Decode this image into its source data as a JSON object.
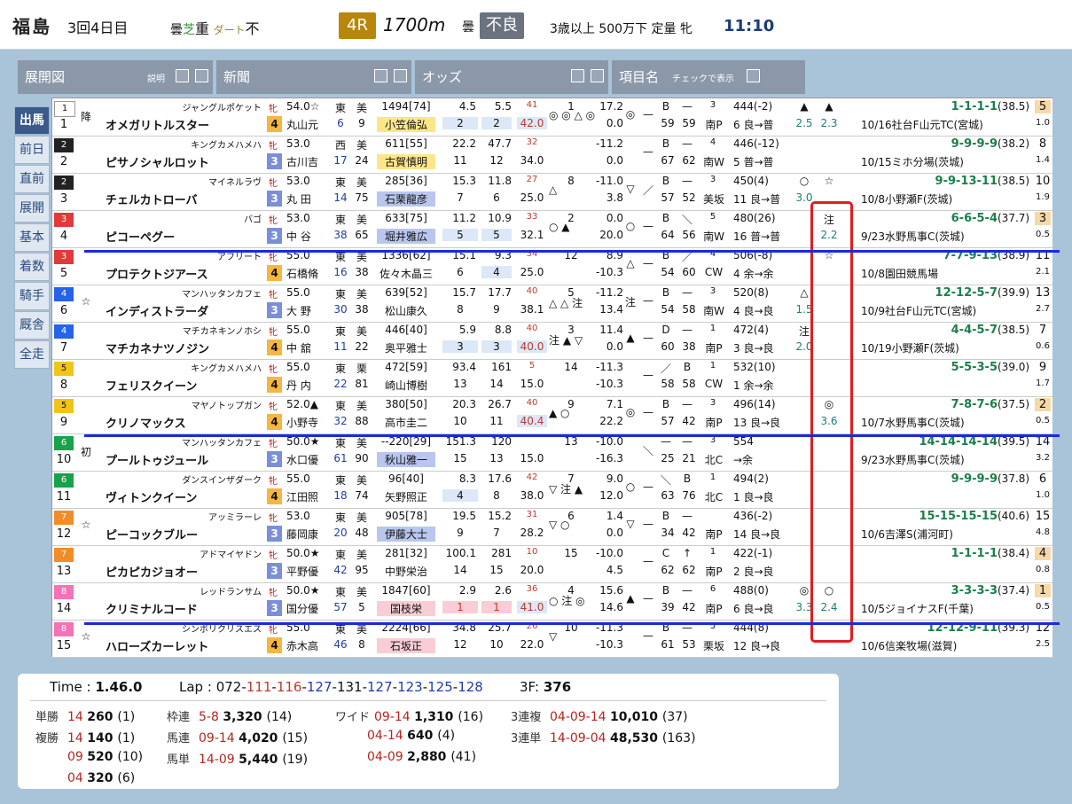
{
  "header": {
    "place": "福島",
    "kai": "3回4日目",
    "turf_label": "曇",
    "turf_kind": "芝",
    "turf_state": "重",
    "dirt_label": "ダート",
    "dirt_state": "不",
    "race_no": "4R",
    "distance": "1700m",
    "weather": "曇",
    "condition": "不良",
    "race_class": "3歳以上 500万下 定量 牝",
    "post_time": "11:10"
  },
  "panels": [
    {
      "title": "展開図",
      "sub": "説明"
    },
    {
      "title": "新聞",
      "sub": ""
    },
    {
      "title": "オッズ",
      "sub": ""
    },
    {
      "title": "項目名",
      "sub": "チェックで表示"
    }
  ],
  "menu": [
    "出馬",
    "前日",
    "直前",
    "展開",
    "基本",
    "着数",
    "騎手",
    "厩舎",
    "全走"
  ],
  "horses": [
    {
      "frame": "1",
      "frame_color": "#ffffff",
      "no": "1",
      "mark": "降",
      "sire": "ジャングルポケット",
      "name": "オメガリトルスター",
      "sex": "牝",
      "age": "4",
      "weight": "54.0☆",
      "jockey": "丸山元",
      "e": "東",
      "m": "美",
      "r1": "6",
      "r2": "9",
      "stat": "1494[74]",
      "trainer": "小笠倫弘",
      "tclass": "jk",
      "o1": "4.5",
      "o2": "5.5",
      "o3": "2",
      "o4": "2",
      "pop": "41",
      "odds": "42.0",
      "marks": "◎ ◎ △ ◎",
      "pos": "1",
      "v1": "17.2",
      "v2": "0.0",
      "c1": "◎",
      "c2": "—",
      "c3": "B",
      "c4": "—",
      "c5": "59",
      "c6": "59",
      "cn": "3",
      "course": "南P",
      "wt": "444(-2)",
      "wt2": "6 良→普",
      "x1": "▲",
      "x2": "▲",
      "x3": "2.5",
      "x4": "2.3",
      "pass": "1-1-1-1",
      "last": "(38.5)",
      "prev": "10/16社台F山元TC(宮城)",
      "rank": "5",
      "rank2": "1.0"
    },
    {
      "frame": "2",
      "frame_color": "#222222",
      "no": "2",
      "mark": "",
      "sire": "キングカメハメハ",
      "name": "ピサノシャルロット",
      "sex": "牝",
      "age": "3",
      "weight": "53.0",
      "jockey": "古川吉",
      "e": "西",
      "m": "美",
      "r1": "17",
      "r2": "24",
      "stat": "611[55]",
      "trainer": "古賀慎明",
      "tclass": "jk",
      "o1": "22.2",
      "o2": "47.7",
      "o3": "11",
      "o4": "12",
      "pop": "32",
      "odds": "34.0",
      "marks": "",
      "pos": "",
      "v1": "-11.2",
      "v2": "0.0",
      "c1": "",
      "c2": "—",
      "c3": "B",
      "c4": "—",
      "c5": "67",
      "c6": "62",
      "cn": "4",
      "course": "南W",
      "wt": "446(-12)",
      "wt2": "5 普→普",
      "x1": "",
      "x2": "",
      "x3": "",
      "x4": "",
      "pass": "9-9-9-9",
      "last": "(38.2)",
      "prev": "10/15ミホ分場(茨城)",
      "rank": "8",
      "rank2": "1.4"
    },
    {
      "frame": "2",
      "frame_color": "#222222",
      "no": "3",
      "mark": "",
      "sire": "マイネルラヴ",
      "name": "チェルカトローバ",
      "sex": "牝",
      "age": "3",
      "weight": "53.0",
      "jockey": "丸 田",
      "e": "東",
      "m": "美",
      "r1": "14",
      "r2": "75",
      "stat": "285[36]",
      "trainer": "石栗龍彦",
      "tclass": "pos3bg",
      "o1": "15.3",
      "o2": "11.8",
      "o3": "7",
      "o4": "6",
      "pop": "27",
      "odds": "25.0",
      "marks": "△",
      "pos": "8",
      "v1": "-11.0",
      "v2": "3.8",
      "c1": "▽",
      "c2": "／",
      "c3": "B",
      "c4": "—",
      "c5": "57",
      "c6": "52",
      "cn": "3",
      "course": "美坂",
      "wt": "450(4)",
      "wt2": "11 良→普",
      "x1": "○",
      "x2": "☆",
      "x3": "3.0",
      "x4": "",
      "pass": "9-9-13-11",
      "last": "(38.5)",
      "prev": "10/8小野瀬F(茨城)",
      "rank": "10",
      "rank2": "1.9"
    },
    {
      "frame": "3",
      "frame_color": "#e03a3a",
      "no": "4",
      "mark": "",
      "sire": "バゴ",
      "name": "ピコーペグー",
      "sex": "牝",
      "age": "3",
      "weight": "53.0",
      "jockey": "中 谷",
      "e": "東",
      "m": "美",
      "r1": "38",
      "r2": "65",
      "stat": "633[75]",
      "trainer": "堀井雅広",
      "tclass": "pos3bg",
      "o1": "11.2",
      "o2": "10.9",
      "o3": "5",
      "o4": "5",
      "pop": "33",
      "odds": "32.1",
      "marks": "○ ▲",
      "pos": "2",
      "v1": "0.0",
      "v2": "20.0",
      "c1": "○",
      "c2": "—",
      "c3": "B",
      "c4": "＼",
      "c5": "64",
      "c6": "56",
      "cn": "5",
      "course": "南W",
      "wt": "480(26)",
      "wt2": "16 普→普",
      "x1": "",
      "x2": "注",
      "x3": "",
      "x4": "2.2",
      "pass": "6-6-5-4",
      "last": "(37.7)",
      "prev": "9/23水野馬事C(茨城)",
      "rank": "3",
      "rank2": "0.5"
    },
    {
      "frame": "3",
      "frame_color": "#e03a3a",
      "no": "5",
      "mark": "",
      "sire": "アフリート",
      "name": "プロテクトジアース",
      "sex": "牝",
      "age": "4",
      "weight": "55.0",
      "jockey": "石橋脩",
      "e": "東",
      "m": "美",
      "r1": "16",
      "r2": "38",
      "stat": "1336[62]",
      "trainer": "佐々木晶三",
      "tclass": "",
      "o1": "15.1",
      "o2": "9.3",
      "o3": "6",
      "o4": "4",
      "pop": "34",
      "odds": "25.0",
      "marks": "",
      "pos": "12",
      "v1": "8.9",
      "v2": "-10.3",
      "c1": "△",
      "c2": "—",
      "c3": "B",
      "c4": "／",
      "c5": "54",
      "c6": "60",
      "cn": "4",
      "course": "CW",
      "wt": "506(-8)",
      "wt2": "4 余→余",
      "x1": "",
      "x2": "☆",
      "x3": "",
      "x4": "",
      "pass": "7-7-9-13",
      "last": "(38.9)",
      "prev": "10/8園田競馬場",
      "rank": "11",
      "rank2": "2.1"
    },
    {
      "frame": "4",
      "frame_color": "#2563eb",
      "no": "6",
      "mark": "☆",
      "sire": "マンハッタンカフェ",
      "name": "インディストラーダ",
      "sex": "牝",
      "age": "3",
      "weight": "55.0",
      "jockey": "大 野",
      "e": "東",
      "m": "美",
      "r1": "30",
      "r2": "38",
      "stat": "639[52]",
      "trainer": "松山康久",
      "tclass": "",
      "o1": "15.7",
      "o2": "17.7",
      "o3": "8",
      "o4": "9",
      "pop": "40",
      "odds": "38.1",
      "marks": "△ △ 注",
      "pos": "5",
      "v1": "-11.2",
      "v2": "13.4",
      "c1": "注",
      "c2": "—",
      "c3": "B",
      "c4": "—",
      "c5": "54",
      "c6": "58",
      "cn": "3",
      "course": "南W",
      "wt": "520(8)",
      "wt2": "4 良→良",
      "x1": "△",
      "x2": "",
      "x3": "1.5",
      "x4": "",
      "pass": "12-12-5-7",
      "last": "(39.9)",
      "prev": "10/9社台F山元TC(宮城)",
      "rank": "13",
      "rank2": "2.7"
    },
    {
      "frame": "4",
      "frame_color": "#2563eb",
      "no": "7",
      "mark": "",
      "sire": "マチカネキンノホシ",
      "name": "マチカネナツノジン",
      "sex": "牝",
      "age": "4",
      "weight": "55.0",
      "jockey": "中 舘",
      "e": "東",
      "m": "美",
      "r1": "11",
      "r2": "22",
      "stat": "446[40]",
      "trainer": "奥平雅士",
      "tclass": "",
      "o1": "5.9",
      "o2": "8.8",
      "o3": "3",
      "o4": "3",
      "pop": "40",
      "odds": "40.0",
      "marks": "注 ▲ ▽",
      "pos": "3",
      "v1": "11.4",
      "v2": "0.0",
      "c1": "▲",
      "c2": "—",
      "c3": "D",
      "c4": "—",
      "c5": "60",
      "c6": "38",
      "cn": "1",
      "course": "南P",
      "wt": "472(4)",
      "wt2": "3 良→良",
      "x1": "注",
      "x2": "",
      "x3": "2.0",
      "x4": "",
      "pass": "4-4-5-7",
      "last": "(38.5)",
      "prev": "10/19小野瀬F(茨城)",
      "rank": "7",
      "rank2": "0.6"
    },
    {
      "frame": "5",
      "frame_color": "#f0c419",
      "no": "8",
      "mark": "",
      "sire": "キングカメハメハ",
      "name": "フェリスクイーン",
      "sex": "牝",
      "age": "4",
      "weight": "55.0",
      "jockey": "丹 内",
      "e": "東",
      "m": "栗",
      "r1": "22",
      "r2": "81",
      "stat": "472[59]",
      "trainer": "崎山博樹",
      "tclass": "",
      "o1": "93.4",
      "o2": "161",
      "o3": "13",
      "o4": "14",
      "pop": "5",
      "odds": "15.0",
      "marks": "",
      "pos": "14",
      "v1": "-11.3",
      "v2": "-10.3",
      "c1": "",
      "c2": "—",
      "c3": "／",
      "c4": "B",
      "c5": "58",
      "c6": "58",
      "cn": "1",
      "course": "CW",
      "wt": "532(10)",
      "wt2": "1 余→余",
      "x1": "",
      "x2": "",
      "x3": "",
      "x4": "",
      "pass": "5-5-3-5",
      "last": "(39.0)",
      "prev": "",
      "rank": "9",
      "rank2": "1.7"
    },
    {
      "frame": "5",
      "frame_color": "#f0c419",
      "no": "9",
      "mark": "",
      "sire": "マヤノトップガン",
      "name": "クリノマックス",
      "sex": "牝",
      "age": "4",
      "weight": "52.0▲",
      "jockey": "小野寺",
      "e": "東",
      "m": "美",
      "r1": "32",
      "r2": "88",
      "stat": "380[50]",
      "trainer": "高市圭二",
      "tclass": "",
      "o1": "20.3",
      "o2": "26.7",
      "o3": "10",
      "o4": "11",
      "pop": "40",
      "odds": "40.4",
      "marks": "▲ ○",
      "pos": "9",
      "v1": "7.1",
      "v2": "22.2",
      "c1": "◎",
      "c2": "—",
      "c3": "B",
      "c4": "—",
      "c5": "57",
      "c6": "42",
      "cn": "3",
      "course": "南P",
      "wt": "496(14)",
      "wt2": "13 良→良",
      "x1": "",
      "x2": "◎",
      "x3": "",
      "x4": "3.6",
      "pass": "7-8-7-6",
      "last": "(37.5)",
      "prev": "10/7水野馬事C(茨城)",
      "rank": "2",
      "rank2": "0.5"
    },
    {
      "frame": "6",
      "frame_color": "#16a34a",
      "no": "10",
      "mark": "初",
      "sire": "マンハッタンカフェ",
      "name": "プールトゥジュール",
      "sex": "牝",
      "age": "3",
      "weight": "50.0★",
      "jockey": "水口優",
      "e": "東",
      "m": "美",
      "r1": "61",
      "r2": "90",
      "stat": "--220[29]",
      "trainer": "秋山雅一",
      "tclass": "pos3bg",
      "o1": "151.3",
      "o2": "120",
      "o3": "15",
      "o4": "13",
      "pop": "",
      "odds": "15.0",
      "marks": "",
      "pos": "13",
      "v1": "-10.0",
      "v2": "-16.3",
      "c1": "",
      "c2": "＼",
      "c3": "—",
      "c4": "—",
      "c5": "25",
      "c6": "21",
      "cn": "3",
      "course": "北C",
      "wt": "554",
      "wt2": "→余",
      "x1": "",
      "x2": "",
      "x3": "",
      "x4": "",
      "pass": "14-14-14-14",
      "last": "(39.5)",
      "prev": "9/23水野馬事C(茨城)",
      "rank": "14",
      "rank2": "3.2"
    },
    {
      "frame": "6",
      "frame_color": "#16a34a",
      "no": "11",
      "mark": "",
      "sire": "ダンスインザダーク",
      "name": "ヴィトンクイーン",
      "sex": "牝",
      "age": "4",
      "weight": "55.0",
      "jockey": "江田照",
      "e": "東",
      "m": "美",
      "r1": "18",
      "r2": "74",
      "stat": "96[40]",
      "trainer": "矢野照正",
      "tclass": "",
      "o1": "8.3",
      "o2": "17.6",
      "o3": "4",
      "o4": "8",
      "pop": "42",
      "odds": "38.0",
      "marks": "▽ 注 ▲",
      "pos": "7",
      "v1": "9.0",
      "v2": "12.0",
      "c1": "○",
      "c2": "—",
      "c3": "＼",
      "c4": "B",
      "c5": "63",
      "c6": "76",
      "cn": "1",
      "course": "北C",
      "wt": "494(2)",
      "wt2": "1 良→良",
      "x1": "",
      "x2": "",
      "x3": "",
      "x4": "",
      "pass": "9-9-9-9",
      "last": "(37.8)",
      "prev": "",
      "rank": "6",
      "rank2": "1.0"
    },
    {
      "frame": "7",
      "frame_color": "#f28c28",
      "no": "12",
      "mark": "☆",
      "sire": "アッミラーレ",
      "name": "ピーコックブルー",
      "sex": "牝",
      "age": "3",
      "weight": "53.0",
      "jockey": "藤岡康",
      "e": "東",
      "m": "美",
      "r1": "20",
      "r2": "48",
      "stat": "905[78]",
      "trainer": "伊藤大士",
      "tclass": "pos3bg",
      "o1": "19.5",
      "o2": "15.2",
      "o3": "9",
      "o4": "7",
      "pop": "31",
      "odds": "28.2",
      "marks": "▽ ○",
      "pos": "6",
      "v1": "1.4",
      "v2": "0.0",
      "c1": "▽",
      "c2": "—",
      "c3": "B",
      "c4": "—",
      "c5": "34",
      "c6": "42",
      "cn": "",
      "course": "南P",
      "wt": "436(-2)",
      "wt2": "14 良→良",
      "x1": "",
      "x2": "",
      "x3": "",
      "x4": "",
      "pass": "15-15-15-15",
      "last": "(40.6)",
      "prev": "10/6吉澤S(浦河町)",
      "rank": "15",
      "rank2": "4.8"
    },
    {
      "frame": "7",
      "frame_color": "#f28c28",
      "no": "13",
      "mark": "",
      "sire": "アドマイヤドン",
      "name": "ピカピカジョオー",
      "sex": "牝",
      "age": "3",
      "weight": "50.0★",
      "jockey": "平野優",
      "e": "東",
      "m": "美",
      "r1": "42",
      "r2": "95",
      "stat": "281[32]",
      "trainer": "中野栄治",
      "tclass": "",
      "o1": "100.1",
      "o2": "281",
      "o3": "14",
      "o4": "15",
      "pop": "10",
      "odds": "20.0",
      "marks": "",
      "pos": "15",
      "v1": "-10.0",
      "v2": "4.5",
      "c1": "",
      "c2": "—",
      "c3": "C",
      "c4": "↑",
      "c5": "62",
      "c6": "62",
      "cn": "1",
      "course": "南P",
      "wt": "422(-1)",
      "wt2": "2 良→良",
      "x1": "",
      "x2": "",
      "x3": "",
      "x4": "",
      "pass": "1-1-1-1",
      "last": "(38.4)",
      "prev": "",
      "rank": "4",
      "rank2": "0.8"
    },
    {
      "frame": "8",
      "frame_color": "#f472b6",
      "no": "14",
      "mark": "",
      "sire": "レッドランサム",
      "name": "クリミナルコード",
      "sex": "牝",
      "age": "3",
      "weight": "50.0★",
      "jockey": "国分優",
      "e": "東",
      "m": "美",
      "r1": "57",
      "r2": "5",
      "stat": "1847[60]",
      "trainer": "国枝栄",
      "tclass": "hl",
      "o1": "2.9",
      "o2": "2.6",
      "o3": "1",
      "o4": "1",
      "pop": "36",
      "odds": "41.0",
      "marks": "○ 注 ◎",
      "pos": "4",
      "v1": "15.6",
      "v2": "14.6",
      "c1": "▲",
      "c2": "—",
      "c3": "B",
      "c4": "—",
      "c5": "39",
      "c6": "42",
      "cn": "6",
      "course": "南P",
      "wt": "488(0)",
      "wt2": "6 良→良",
      "x1": "◎",
      "x2": "○",
      "x3": "3.3",
      "x4": "2.4",
      "pass": "3-3-3-3",
      "last": "(37.4)",
      "prev": "10/5ジョイナスF(千葉)",
      "rank": "1",
      "rank2": "0.5"
    },
    {
      "frame": "8",
      "frame_color": "#f472b6",
      "no": "15",
      "mark": "☆",
      "sire": "シンボリクリスエス",
      "name": "ハローズカーレット",
      "sex": "牝",
      "age": "4",
      "weight": "55.0",
      "jockey": "赤木高",
      "e": "東",
      "m": "美",
      "r1": "46",
      "r2": "8",
      "stat": "2224[66]",
      "trainer": "石坂正",
      "tclass": "hl",
      "o1": "34.8",
      "o2": "25.7",
      "o3": "12",
      "o4": "10",
      "pop": "26",
      "odds": "22.0",
      "marks": "▽",
      "pos": "10",
      "v1": "-11.3",
      "v2": "-10.3",
      "c1": "",
      "c2": "—",
      "c3": "B",
      "c4": "—",
      "c5": "61",
      "c6": "53",
      "cn": "5",
      "course": "栗坂",
      "wt": "444(8)",
      "wt2": "12 良→良",
      "x1": "",
      "x2": "",
      "x3": "",
      "x4": "",
      "pass": "12-12-9-11",
      "last": "(39.3)",
      "prev": "10/6信楽牧場(滋賀)",
      "rank": "12",
      "rank2": "2.5"
    }
  ],
  "result": {
    "time_label": "Time :",
    "time": "1.46.0",
    "lap_label": "Lap :",
    "laps": [
      "072",
      "111",
      "116",
      "127",
      "131",
      "127",
      "123",
      "125",
      "128"
    ],
    "f3_label": "3F:",
    "f3": "376",
    "pays": [
      {
        "kind": "単勝",
        "combo": "14",
        "amount": "260",
        "pop": "(1)"
      },
      {
        "kind": "複勝",
        "combo": "14",
        "amount": "140",
        "pop": "(1)"
      },
      {
        "kind": "",
        "combo": "09",
        "amount": "520",
        "pop": "(10)"
      },
      {
        "kind": "",
        "combo": "04",
        "amount": "320",
        "pop": "(6)"
      },
      {
        "kind": "枠連",
        "combo": "5-8",
        "amount": "3,320",
        "pop": "(14)"
      },
      {
        "kind": "馬連",
        "combo": "09-14",
        "amount": "4,020",
        "pop": "(15)"
      },
      {
        "kind": "馬単",
        "combo": "14-09",
        "amount": "5,440",
        "pop": "(19)"
      },
      {
        "kind": "ワイド",
        "combo": "09-14",
        "amount": "1,310",
        "pop": "(16)"
      },
      {
        "kind": "",
        "combo": "04-14",
        "amount": "640",
        "pop": "(4)"
      },
      {
        "kind": "",
        "combo": "04-09",
        "amount": "2,880",
        "pop": "(41)"
      },
      {
        "kind": "3連複",
        "combo": "04-09-14",
        "amount": "10,010",
        "pop": "(37)"
      },
      {
        "kind": "3連単",
        "combo": "14-09-04",
        "amount": "48,530",
        "pop": "(163)"
      }
    ]
  },
  "colors": {
    "accent": "#b8860b",
    "condition": "#6b7280",
    "divider": "#1d2ad8",
    "highlight": "#e21d1d"
  },
  "icons": [
    "checkbox-icon"
  ]
}
